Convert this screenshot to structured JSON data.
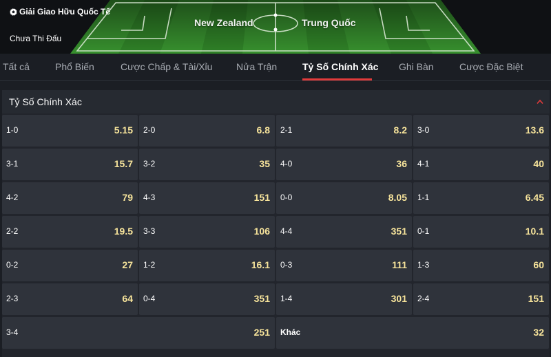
{
  "match": {
    "league": "Giải Giao Hữu Quốc Tế",
    "status": "Chưa Thi Đấu",
    "home_team": "New Zealand",
    "away_team": "Trung Quốc"
  },
  "tabs": [
    "Tất cả",
    "Phổ Biến",
    "Cược Chấp & Tài/Xỉu",
    "Nửa Trận",
    "Tỷ Số Chính Xác",
    "Ghi Bàn",
    "Cược Đặc Biệt"
  ],
  "active_tab": "Tỷ Số Chính Xác",
  "market": {
    "title": "Tỷ Số Chính Xác",
    "rows": [
      [
        {
          "score": "1-0",
          "odds": "5.15"
        },
        {
          "score": "2-0",
          "odds": "6.8"
        },
        {
          "score": "2-1",
          "odds": "8.2"
        },
        {
          "score": "3-0",
          "odds": "13.6"
        }
      ],
      [
        {
          "score": "3-1",
          "odds": "15.7"
        },
        {
          "score": "3-2",
          "odds": "35"
        },
        {
          "score": "4-0",
          "odds": "36"
        },
        {
          "score": "4-1",
          "odds": "40"
        }
      ],
      [
        {
          "score": "4-2",
          "odds": "79"
        },
        {
          "score": "4-3",
          "odds": "151"
        },
        {
          "score": "0-0",
          "odds": "8.05"
        },
        {
          "score": "1-1",
          "odds": "6.45"
        }
      ],
      [
        {
          "score": "2-2",
          "odds": "19.5"
        },
        {
          "score": "3-3",
          "odds": "106"
        },
        {
          "score": "4-4",
          "odds": "351"
        },
        {
          "score": "0-1",
          "odds": "10.1"
        }
      ],
      [
        {
          "score": "0-2",
          "odds": "27"
        },
        {
          "score": "1-2",
          "odds": "16.1"
        },
        {
          "score": "0-3",
          "odds": "111"
        },
        {
          "score": "1-3",
          "odds": "60"
        }
      ],
      [
        {
          "score": "2-3",
          "odds": "64"
        },
        {
          "score": "0-4",
          "odds": "351"
        },
        {
          "score": "1-4",
          "odds": "301"
        },
        {
          "score": "2-4",
          "odds": "151"
        }
      ],
      [
        {
          "score": "3-4",
          "odds": "251"
        },
        {
          "score": "Khác",
          "odds": "32"
        }
      ]
    ]
  },
  "colors": {
    "accent": "#e23b3b",
    "odds": "#f7e49b",
    "cell": "#2f333b",
    "pitch_light": "#3f9a35",
    "pitch_dark": "#2f7f28"
  }
}
